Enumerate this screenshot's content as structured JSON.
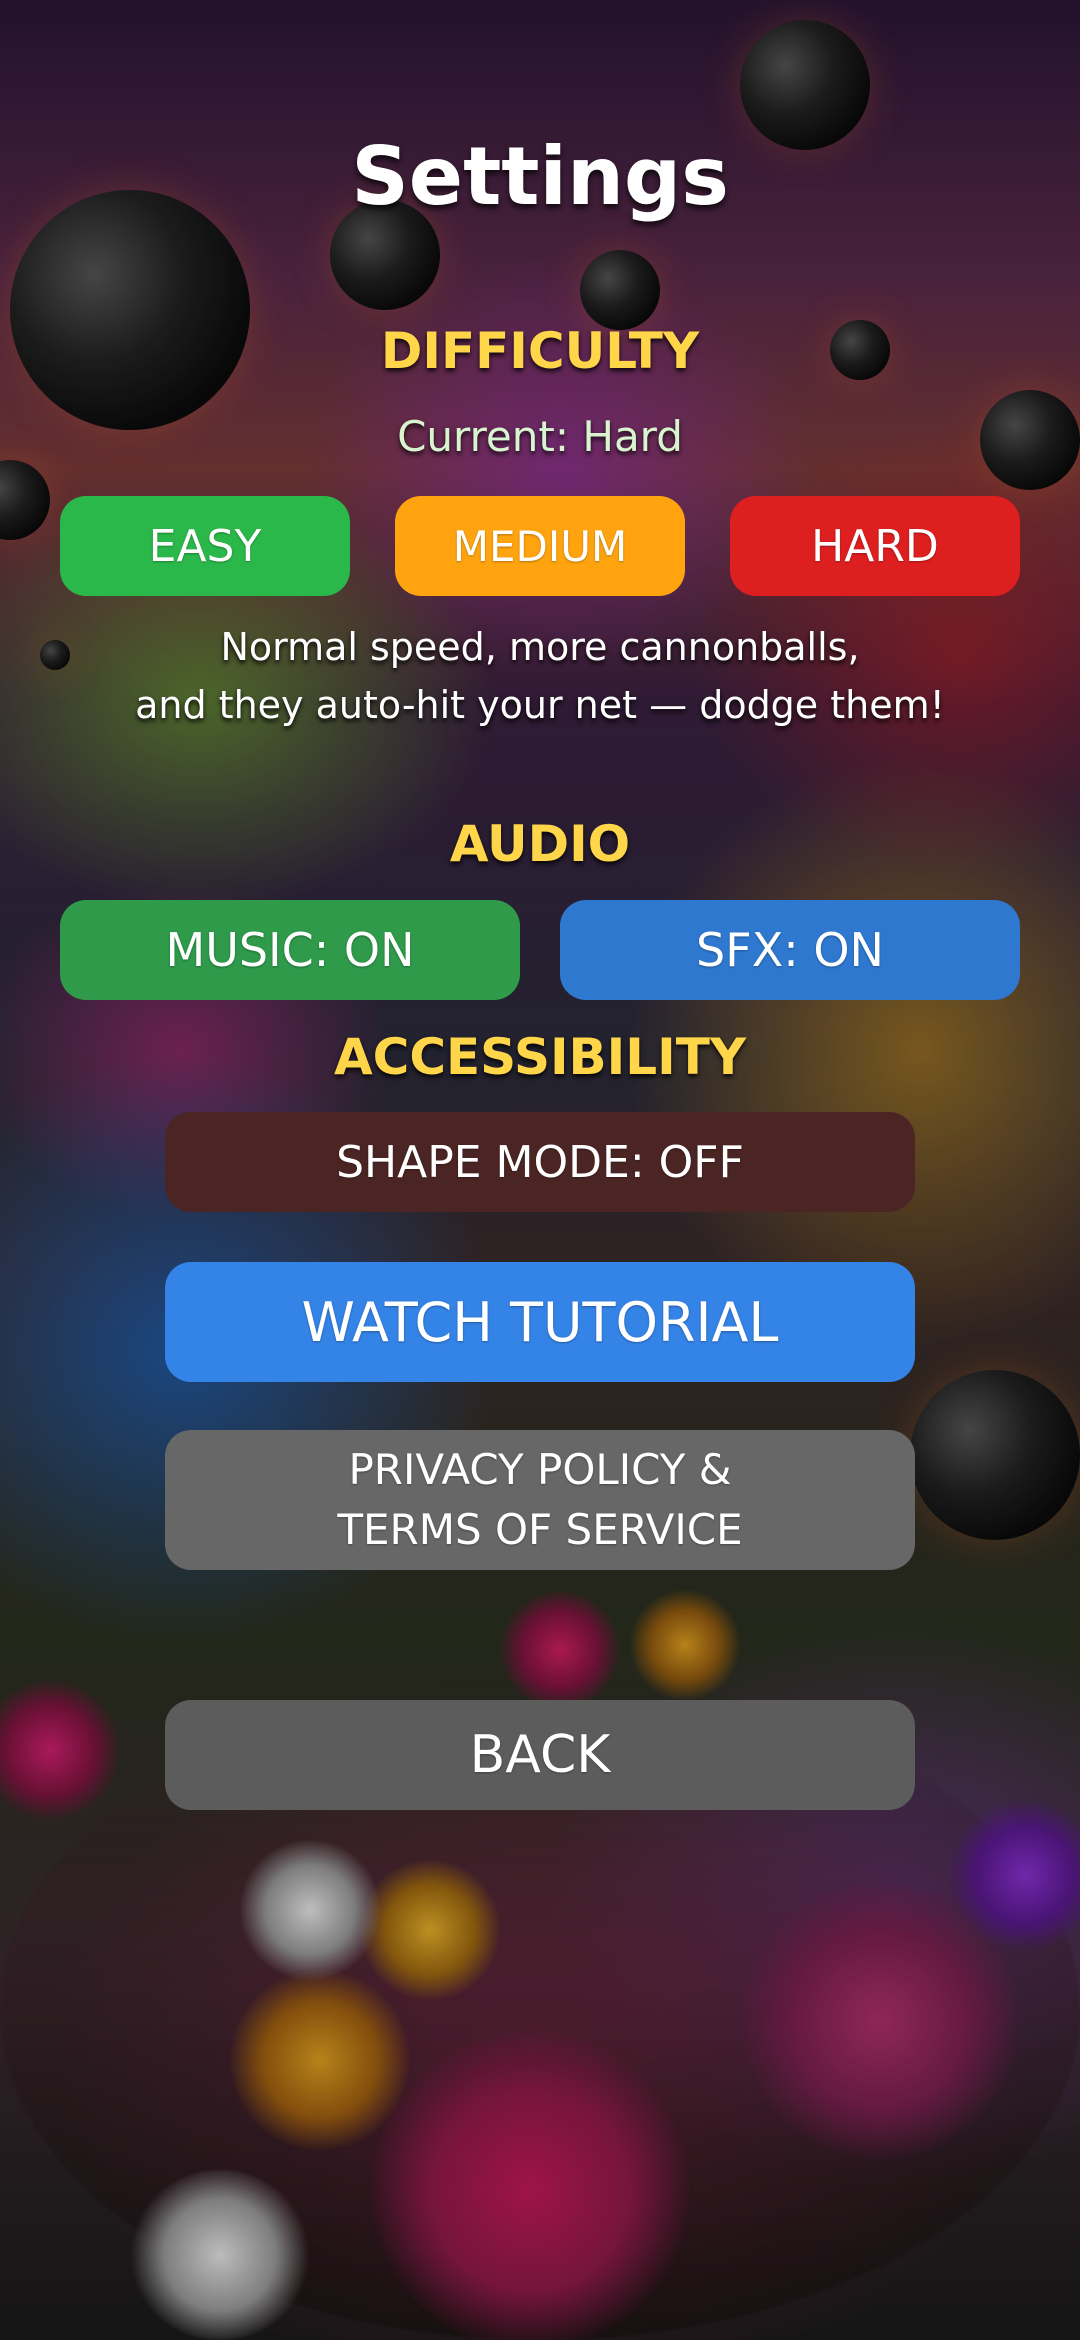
{
  "title": "Settings",
  "difficulty": {
    "heading": "DIFFICULTY",
    "current": "Current: Hard",
    "buttons": [
      {
        "label": "EASY",
        "color": "#2bb84a"
      },
      {
        "label": "MEDIUM",
        "color": "#ffa40f"
      },
      {
        "label": "HARD",
        "color": "#de1f1f"
      }
    ],
    "description": {
      "line1": "Normal speed, more cannonballs,",
      "line2": "and they auto-hit your net — dodge them!"
    }
  },
  "audio": {
    "heading": "AUDIO",
    "music_label": "MUSIC: ON",
    "music_color": "#2e9a4a",
    "sfx_label": "SFX: ON",
    "sfx_color": "#2f78cf"
  },
  "accessibility": {
    "heading": "ACCESSIBILITY",
    "shape_mode_label": "SHAPE MODE: OFF",
    "shape_mode_color": "#4b2523"
  },
  "tutorial": {
    "label": "WATCH TUTORIAL",
    "color": "#3483e6"
  },
  "privacy": {
    "line1": "PRIVACY POLICY &",
    "line2": "TERMS OF SERVICE",
    "color": "#676767"
  },
  "back": {
    "label": "BACK",
    "color": "#5c5c5c"
  },
  "background": "butterflies-flowers-cannonballs-scene"
}
